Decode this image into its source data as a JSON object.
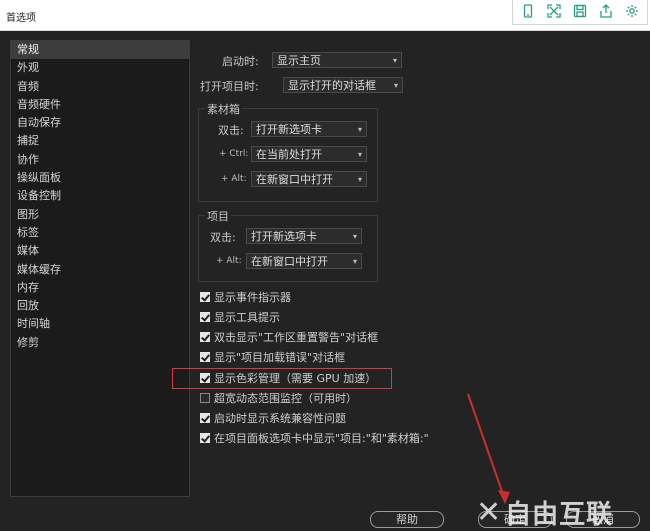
{
  "window": {
    "title": "首选项"
  },
  "toolbar_icons": [
    "phone-icon",
    "expand-icon",
    "save-icon",
    "export-icon",
    "gear-icon"
  ],
  "sidebar": {
    "items": [
      "常规",
      "外观",
      "音频",
      "音频硬件",
      "自动保存",
      "捕捉",
      "协作",
      "操纵面板",
      "设备控制",
      "图形",
      "标签",
      "媒体",
      "媒体缓存",
      "内存",
      "回放",
      "时间轴",
      "修剪"
    ],
    "active_index": 0
  },
  "general": {
    "startup_label": "启动时:",
    "startup_value": "显示主页",
    "open_project_label": "打开项目时:",
    "open_project_value": "显示打开的对话框",
    "bin": {
      "title": "素材箱",
      "double_click_label": "双击:",
      "double_click_value": "打开新选项卡",
      "ctrl_label": "+ Ctrl:",
      "ctrl_value": "在当前处打开",
      "alt_label": "+ Alt:",
      "alt_value": "在新窗口中打开"
    },
    "project": {
      "title": "项目",
      "double_click_label": "双击:",
      "double_click_value": "打开新选项卡",
      "alt_label": "+ Alt:",
      "alt_value": "在新窗口中打开"
    },
    "checkboxes": [
      {
        "label": "显示事件指示器",
        "checked": true
      },
      {
        "label": "显示工具提示",
        "checked": true
      },
      {
        "label": "双击显示\"工作区重置警告\"对话框",
        "checked": true
      },
      {
        "label": "显示\"项目加载错误\"对话框",
        "checked": true
      },
      {
        "label": "显示色彩管理（需要 GPU 加速）",
        "checked": true
      },
      {
        "label": "超宽动态范围监控（可用时）",
        "checked": false
      },
      {
        "label": "启动时显示系统兼容性问题",
        "checked": true
      },
      {
        "label": "在项目面板选项卡中显示\"项目:\"和\"素材箱:\"",
        "checked": true
      }
    ]
  },
  "footer": {
    "help": "帮助",
    "ok": "确定",
    "cancel": "取消"
  },
  "watermark": {
    "text": "自由互联"
  },
  "colors": {
    "accent_teal": "#2a9a8a",
    "highlight_red": "#d63b3b"
  }
}
